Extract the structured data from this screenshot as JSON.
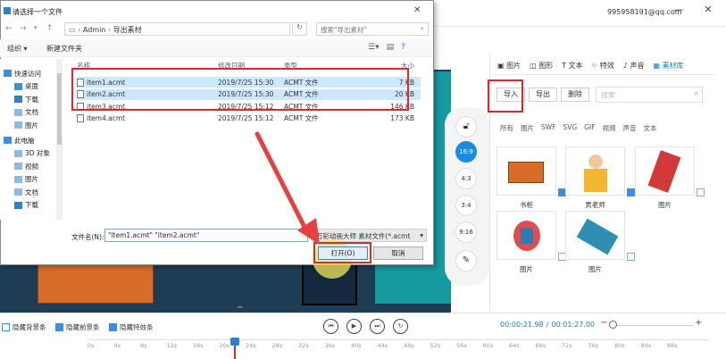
{
  "app": {
    "account": "995958191@qq.com",
    "right_tabs": [
      "图片",
      "图形",
      "文本",
      "特效",
      "声音",
      "素材库"
    ],
    "active_tab_index": 5,
    "import_label": "导入",
    "export_label": "导出",
    "delete_label": "删除",
    "search_placeholder": "搜索",
    "filters": [
      "所有",
      "图片",
      "SWF",
      "SVG",
      "GIF",
      "视频",
      "声音",
      "文本"
    ],
    "assets": [
      {
        "label": "书柜",
        "checked": true
      },
      {
        "label": "男老师",
        "checked": true
      },
      {
        "label": "图片",
        "checked": false
      },
      {
        "label": "图片",
        "checked": false
      },
      {
        "label": "图片",
        "checked": false
      }
    ],
    "ratios": [
      "16:9",
      "4:3",
      "3:4",
      "9:16"
    ],
    "active_ratio_index": 0
  },
  "dialog": {
    "title": "请选择一个文件",
    "path_root": "Admin",
    "path_folder": "导出素材",
    "search_placeholder": "搜索\"导出素材\"",
    "organize_label": "组织 ▾",
    "new_folder_label": "新建文件夹",
    "sidebar": [
      {
        "label": "快速访问",
        "icon": "star-icon",
        "color": "#3f8fd6"
      },
      {
        "label": "桌面",
        "icon": "desktop-icon",
        "color": "#3f8fd6"
      },
      {
        "label": "下载",
        "icon": "download-icon",
        "color": "#2d7dd2"
      },
      {
        "label": "文档",
        "icon": "document-icon",
        "color": "#8fb9e6"
      },
      {
        "label": "图片",
        "icon": "picture-icon",
        "color": "#8fb9e6"
      },
      {
        "label": "此电脑",
        "icon": "computer-icon",
        "color": "#3f8fd6"
      },
      {
        "label": "3D 对象",
        "icon": "cube-icon",
        "color": "#8fb9e6"
      },
      {
        "label": "视频",
        "icon": "video-icon",
        "color": "#8fb9e6"
      },
      {
        "label": "图片",
        "icon": "picture-icon",
        "color": "#8fb9e6"
      },
      {
        "label": "文档",
        "icon": "document-icon",
        "color": "#8fb9e6"
      },
      {
        "label": "下载",
        "icon": "download-icon",
        "color": "#2d7dd2"
      }
    ],
    "columns": {
      "name": "名称",
      "date": "修改日期",
      "type": "类型",
      "size": "大小"
    },
    "files": [
      {
        "name": "item1.acmt",
        "date": "2019/7/25 15:30",
        "type": "ACMT 文件",
        "size": "7 KB",
        "selected": true
      },
      {
        "name": "item2.acmt",
        "date": "2019/7/25 15:30",
        "type": "ACMT 文件",
        "size": "20 KB",
        "selected": true
      },
      {
        "name": "item3.acmt",
        "date": "2019/7/25 15:12",
        "type": "ACMT 文件",
        "size": "146 KB",
        "selected": false
      },
      {
        "name": "item4.acmt",
        "date": "2019/7/25 15:12",
        "type": "ACMT 文件",
        "size": "173 KB",
        "selected": false
      }
    ],
    "filename_label": "文件名(N):",
    "filename_value": "\"item1.acmt\" \"item2.acmt\"",
    "filetype_value": "万彩动画大师 素材文件(*.acmt",
    "open_label": "打开(O)",
    "cancel_label": "取消"
  },
  "timeline": {
    "checks": [
      {
        "label": "隐藏背景条",
        "checked": false
      },
      {
        "label": "隐藏前景条",
        "checked": true
      },
      {
        "label": "隐藏特效条",
        "checked": true
      }
    ],
    "current_time": "00:00:21.98",
    "separator": "/",
    "total_time": "00:01:27.00",
    "ruler": [
      "0s",
      "4s",
      "8s",
      "12s",
      "16s",
      "20s",
      "24s",
      "28s",
      "32s",
      "36s",
      "40s",
      "44s",
      "48s",
      "52s",
      "56s",
      "60s",
      "64s",
      "68s",
      "72s",
      "76s",
      "80s",
      "84s",
      "88s"
    ],
    "playhead_seconds": 21.98
  }
}
